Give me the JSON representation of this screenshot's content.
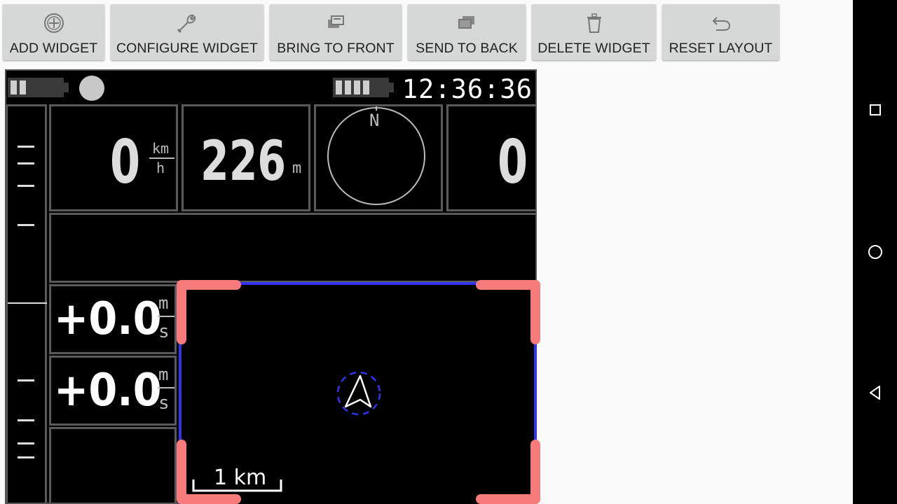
{
  "toolbar": {
    "add": "ADD WIDGET",
    "configure": "CONFIGURE WIDGET",
    "front": "BRING TO FRONT",
    "back": "SEND TO BACK",
    "delete": "DELETE WIDGET",
    "reset": "RESET LAYOUT"
  },
  "status": {
    "clock": "12:36:36"
  },
  "widgets": {
    "speed": {
      "value": "0",
      "unit_top": "km",
      "unit_bottom": "h"
    },
    "altitude": {
      "value": "226",
      "unit": "m"
    },
    "compass": {
      "north": "N"
    },
    "fourth": {
      "value": "0"
    },
    "vario1": {
      "value": "+0.0",
      "unit_top": "m",
      "unit_bottom": "s"
    },
    "vario2": {
      "value": "+0.0",
      "unit_top": "m",
      "unit_bottom": "s"
    },
    "map": {
      "scale": "1 km"
    }
  },
  "colors": {
    "selection_frame": "#3333ee",
    "selection_handles": "#f77b7b"
  }
}
